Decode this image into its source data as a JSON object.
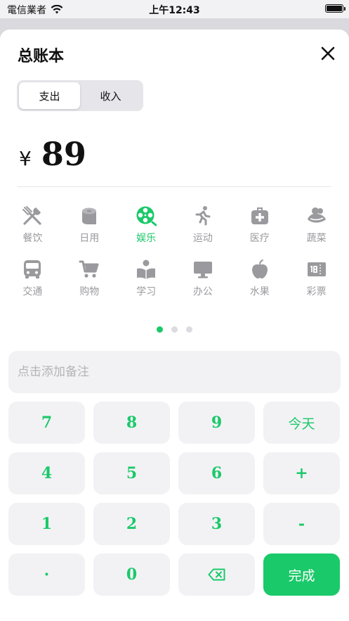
{
  "status_bar": {
    "carrier": "電信業者",
    "time": "上午12:43"
  },
  "sheet": {
    "title": "总账本"
  },
  "segment": {
    "expense": "支出",
    "income": "收入"
  },
  "amount": {
    "currency": "¥",
    "value": "89"
  },
  "categories": [
    {
      "label": "餐饮",
      "icon": "utensils-icon",
      "active": false
    },
    {
      "label": "日用",
      "icon": "toilet-paper-icon",
      "active": false
    },
    {
      "label": "娱乐",
      "icon": "film-reel-icon",
      "active": true
    },
    {
      "label": "运动",
      "icon": "running-icon",
      "active": false
    },
    {
      "label": "医疗",
      "icon": "medical-kit-icon",
      "active": false
    },
    {
      "label": "蔬菜",
      "icon": "vegetable-icon",
      "active": false
    },
    {
      "label": "交通",
      "icon": "bus-icon",
      "active": false
    },
    {
      "label": "购物",
      "icon": "shopping-cart-icon",
      "active": false
    },
    {
      "label": "学习",
      "icon": "reading-icon",
      "active": false
    },
    {
      "label": "办公",
      "icon": "monitor-icon",
      "active": false
    },
    {
      "label": "水果",
      "icon": "apple-icon",
      "active": false
    },
    {
      "label": "彩票",
      "icon": "lottery-ticket-icon",
      "active": false
    }
  ],
  "pager": {
    "pages": 3,
    "current": 1
  },
  "note": {
    "placeholder": "点击添加备注"
  },
  "keypad": {
    "keys": [
      "7",
      "8",
      "9",
      "今天",
      "4",
      "5",
      "6",
      "+",
      "1",
      "2",
      "3",
      "-",
      "·",
      "0",
      "",
      "完成"
    ]
  },
  "colors": {
    "accent": "#1ac969",
    "icon_gray": "#9a9a9e",
    "key_bg": "#f2f2f5"
  }
}
